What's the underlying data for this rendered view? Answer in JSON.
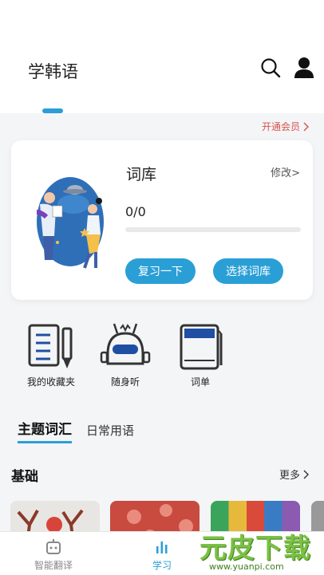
{
  "header": {
    "title": "学韩语"
  },
  "vip": {
    "label": "开通会员"
  },
  "vocab_card": {
    "title": "词库",
    "edit_label": "修改>",
    "progress_text": "0/0",
    "progress_fraction": 0,
    "review_button": "复习一下",
    "choose_button": "选择词库"
  },
  "quick_actions": [
    {
      "label": "我的收藏夹",
      "icon": "notebook-pencil-icon"
    },
    {
      "label": "随身听",
      "icon": "robot-radio-icon"
    },
    {
      "label": "词单",
      "icon": "book-icon"
    }
  ],
  "subtabs": {
    "active": "主题词汇",
    "inactive": "日常用语"
  },
  "section": {
    "title": "基础",
    "more_label": "更多"
  },
  "bottom_nav": {
    "translate_label": "智能翻译",
    "learn_label": "学习"
  },
  "watermark": {
    "main": "元皮下载",
    "sub": "www.yuanpi.com"
  },
  "colors": {
    "accent": "#2a9fd6",
    "vip": "#d9534f",
    "watermark": "#7ac143"
  }
}
